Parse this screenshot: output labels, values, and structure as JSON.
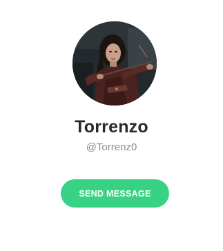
{
  "profile": {
    "display_name": "Torrenzo",
    "handle": "@Torrenz0",
    "avatar": "archer-portrait"
  },
  "actions": {
    "send_message_label": "SEND MESSAGE"
  },
  "colors": {
    "accent": "#37d283",
    "name_text": "#2a2a2a",
    "handle_text": "#8b8b8b",
    "background": "#ffffff"
  }
}
